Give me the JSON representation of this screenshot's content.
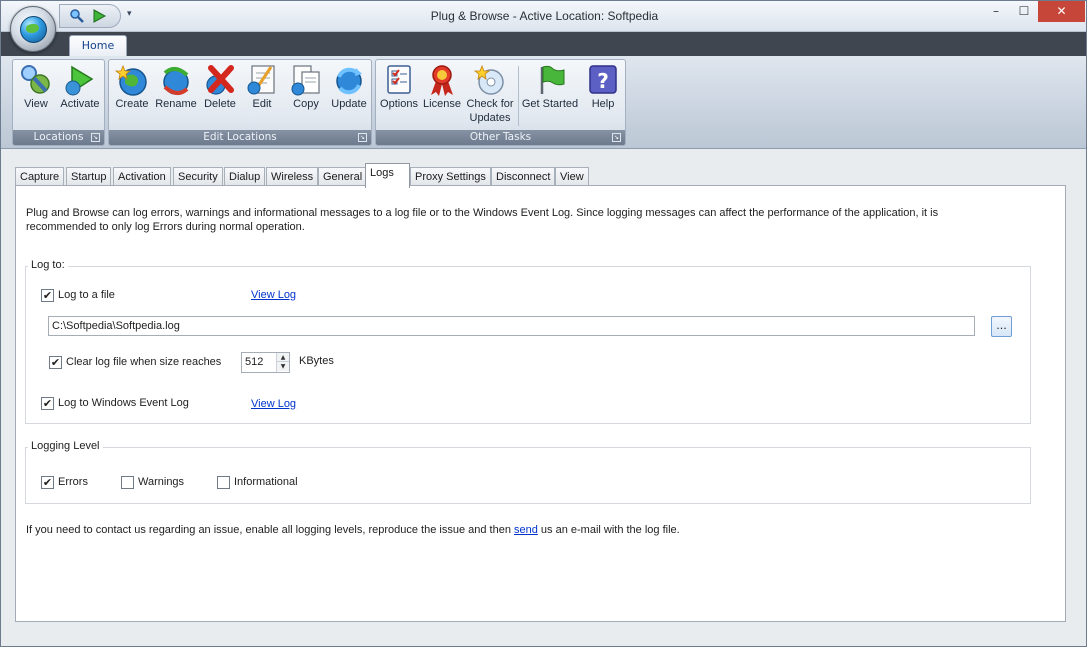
{
  "window": {
    "title": "Plug & Browse - Active Location: Softpedia",
    "controls": {
      "minimize": "–",
      "maximize": "☐",
      "close": "✕"
    }
  },
  "ribbon": {
    "tab": "Home",
    "groups": [
      {
        "label": "Locations",
        "buttons": [
          {
            "label": "View",
            "icon": "view-icon"
          },
          {
            "label": "Activate",
            "icon": "activate-icon"
          }
        ]
      },
      {
        "label": "Edit Locations",
        "buttons": [
          {
            "label": "Create",
            "icon": "create-icon"
          },
          {
            "label": "Rename",
            "icon": "rename-icon"
          },
          {
            "label": "Delete",
            "icon": "delete-icon"
          },
          {
            "label": "Edit",
            "icon": "edit-icon"
          },
          {
            "label": "Copy",
            "icon": "copy-icon"
          },
          {
            "label": "Update",
            "icon": "update-icon"
          }
        ]
      },
      {
        "label": "Other Tasks",
        "buttons": [
          {
            "label": "Options",
            "icon": "options-icon"
          },
          {
            "label": "License",
            "icon": "license-icon"
          },
          {
            "label": "Check for",
            "label2": "Updates",
            "icon": "check-updates-icon"
          },
          {
            "label": "Get Started",
            "icon": "get-started-icon"
          },
          {
            "label": "Help",
            "icon": "help-icon"
          }
        ]
      }
    ]
  },
  "tabs": [
    "Capture",
    "Startup",
    "Activation",
    "Security",
    "Dialup",
    "Wireless",
    "General",
    "Logs",
    "Proxy Settings",
    "Disconnect",
    "View"
  ],
  "active_tab": "Logs",
  "logs": {
    "intro_line1": "Plug and Browse can log errors, warnings and informational messages to a log file or to the Windows Event Log. Since logging messages can affect the performance of the application, it is",
    "intro_line2": "recommended to only log Errors during normal operation.",
    "log_to": {
      "legend": "Log to:",
      "log_to_file": "Log to a file",
      "view_log_file": "View Log",
      "file_path": "C:\\Softpedia\\Softpedia.log",
      "browse": "...",
      "clear_log": "Clear log file when size reaches",
      "size_value": "512",
      "size_unit": "KBytes",
      "log_to_event": "Log to Windows Event Log",
      "view_log_event": "View Log",
      "checked": "✔"
    },
    "level": {
      "legend": "Logging Level",
      "errors": "Errors",
      "warnings": "Warnings",
      "informational": "Informational"
    },
    "footer_before": "If you need to contact us regarding an issue, enable all logging levels, reproduce the issue and then ",
    "footer_link": "send",
    "footer_after": " us an e-mail with the log file."
  }
}
